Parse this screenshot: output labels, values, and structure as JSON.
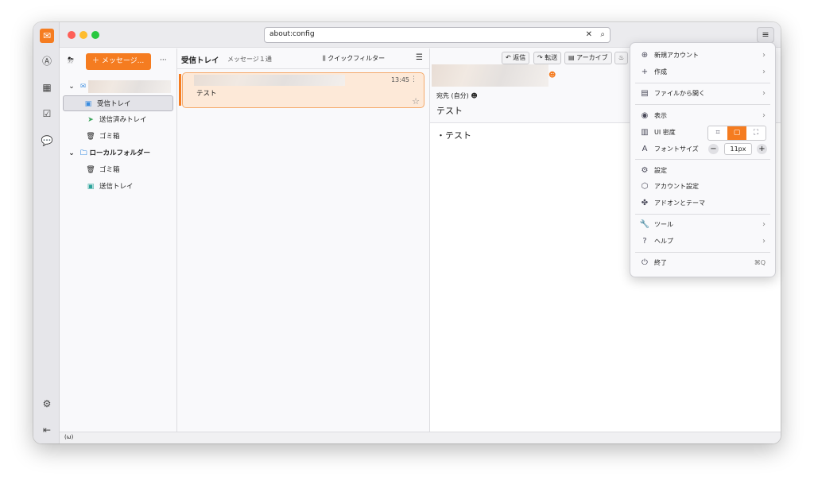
{
  "url_bar": {
    "value": "about:config"
  },
  "folder_pane": {
    "new_message": "＋ メッセージ...",
    "more": "···",
    "account_name_blurred": "",
    "folders": [
      {
        "label": "受信トレイ",
        "icon": "inbox-icon"
      },
      {
        "label": "送信済みトレイ",
        "icon": "sent-icon"
      },
      {
        "label": "ゴミ箱",
        "icon": "trash-icon"
      }
    ],
    "local": {
      "label": "ローカルフォルダー",
      "folders": [
        {
          "label": "ゴミ箱"
        },
        {
          "label": "送信トレイ"
        }
      ]
    }
  },
  "message_list": {
    "title": "受信トレイ",
    "count": "メッセージ１通",
    "quick_filter": "クイックフィルター",
    "messages": [
      {
        "time": "13:45",
        "subject": "テスト"
      }
    ]
  },
  "reader": {
    "buttons": [
      "返信",
      "転送",
      "アーカイブ"
    ],
    "to": "宛先 (自分)",
    "subject": "テスト",
    "body": "・テスト"
  },
  "app_menu": {
    "items": {
      "new_account": "新規アカウント",
      "create": "作成",
      "open_file": "ファイルから開く",
      "view": "表示",
      "ui_density": "UI 密度",
      "font_size": "フォントサイズ",
      "font_size_value": "11px",
      "settings": "設定",
      "account_settings": "アカウント設定",
      "addons": "アドオンとテーマ",
      "tools": "ツール",
      "help": "ヘルプ",
      "quit": "終了",
      "quit_shortcut": "⌘Q"
    }
  },
  "status_bar": {
    "icon": "(ω)"
  },
  "colors": {
    "accent": "#f57c20"
  }
}
